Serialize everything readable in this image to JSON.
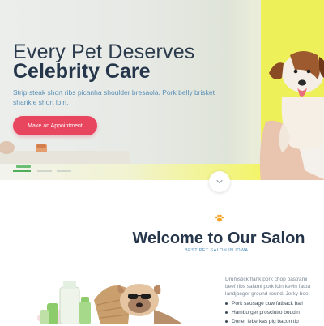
{
  "hero": {
    "title_line1": "Every Pet Deserves",
    "title_line2": "Celebrity Care",
    "description": "Strip steak short ribs picanha shoulder bresaola. Pork belly brisket shankle short loin.",
    "cta_label": "Make an Appointment",
    "slider_count": 3,
    "active_slide": 1
  },
  "welcome": {
    "title": "Welcome to Our Salon",
    "subtitle": "BEST PET SALON IN IOWA",
    "paragraph_lines": [
      "Drumstick flank pork chop pastrami",
      "beef ribs salami pork loin kevin fatba",
      "landjaeger ground round. Jerky bee"
    ],
    "list": [
      "Pork sausage cow fatback ball",
      "Hamburger prosciutto boudin",
      "Doner leberkas pig bacon tip"
    ]
  },
  "colors": {
    "accent": "#e8465f",
    "heading": "#25354a",
    "link_blue": "#4a8bb8",
    "yellow": "#eef05a",
    "green": "#4fae5a",
    "paw": "#f3a11c"
  },
  "icons": {
    "scroll": "chevron-down-icon",
    "paw": "paw-icon"
  }
}
